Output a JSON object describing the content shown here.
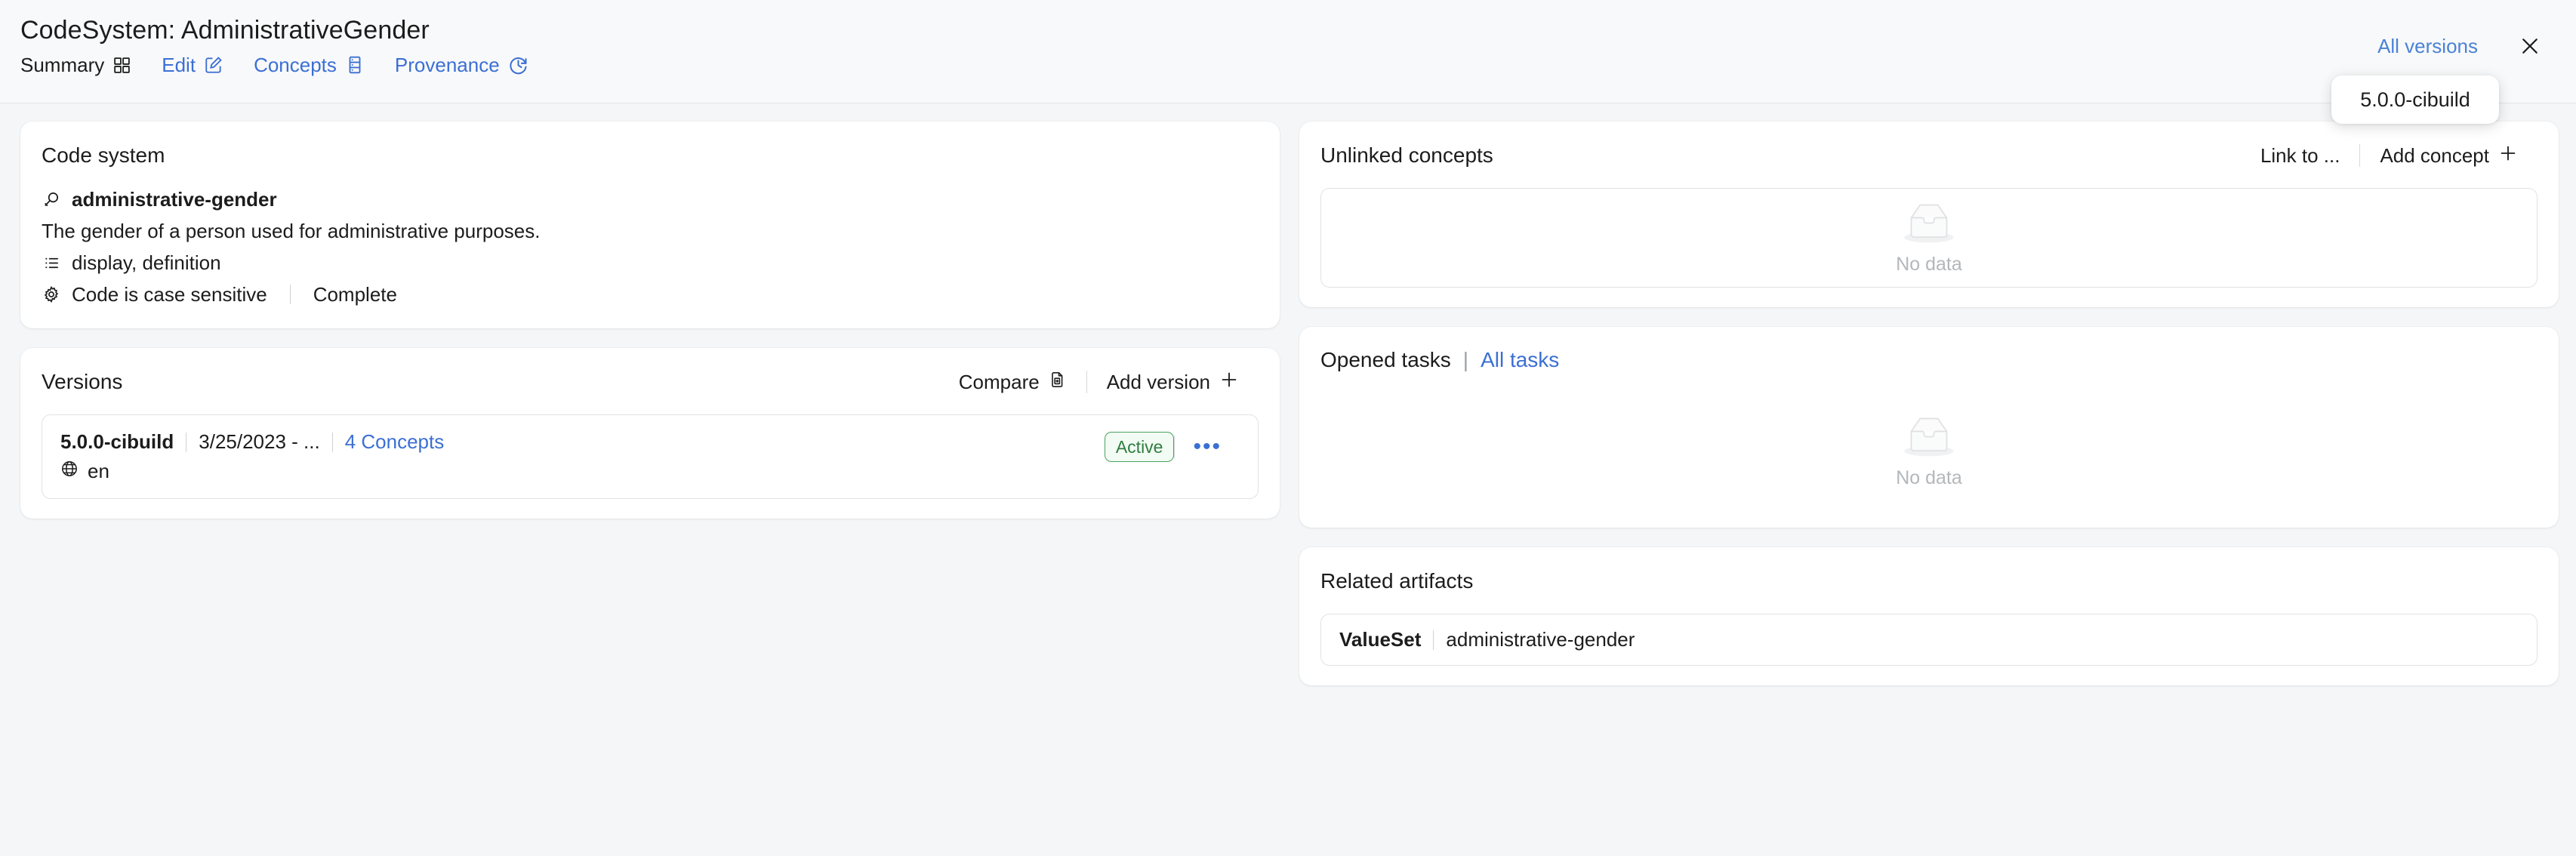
{
  "header": {
    "title": "CodeSystem: AdministrativeGender",
    "tabs": [
      {
        "label": "Summary",
        "icon": "grid-icon",
        "active": true
      },
      {
        "label": "Edit",
        "icon": "edit-icon",
        "active": false
      },
      {
        "label": "Concepts",
        "icon": "concepts-icon",
        "active": false
      },
      {
        "label": "Provenance",
        "icon": "history-clock-icon",
        "active": false
      }
    ],
    "all_versions_label": "All versions",
    "close_label": "×",
    "version_dropdown": {
      "items": [
        "5.0.0-cibuild"
      ]
    }
  },
  "code_system": {
    "card_title": "Code system",
    "name": "administrative-gender",
    "description": "The gender of a person used for administrative purposes.",
    "properties": "display, definition",
    "case_sensitivity": "Code is case sensitive",
    "content_mode": "Complete"
  },
  "versions": {
    "card_title": "Versions",
    "actions": {
      "compare_label": "Compare",
      "add_version_label": "Add version"
    },
    "items": [
      {
        "version": "5.0.0-cibuild",
        "date_range": "3/25/2023 - ...",
        "concepts_link": "4 Concepts",
        "language": "en",
        "status": "Active",
        "more_label": "•••"
      }
    ]
  },
  "unlinked_concepts": {
    "card_title": "Unlinked concepts",
    "actions": {
      "link_to_label": "Link to ...",
      "add_concept_label": "Add concept"
    },
    "empty_label": "No data"
  },
  "opened_tasks": {
    "card_title": "Opened tasks",
    "separator": "|",
    "all_tasks_label": "All tasks",
    "empty_label": "No data"
  },
  "related_artifacts": {
    "card_title": "Related artifacts",
    "items": [
      {
        "type": "ValueSet",
        "value": "administrative-gender"
      }
    ]
  },
  "colors": {
    "accent_blue": "#3b6fd4",
    "link_blue": "#4a82d6",
    "active_green": "#48a35c",
    "active_green_bg": "#f2fbf4",
    "page_bg": "#f4f6f8",
    "card_bg": "#ffffff",
    "border": "#e0e2e5",
    "muted": "#b4b7ba"
  }
}
